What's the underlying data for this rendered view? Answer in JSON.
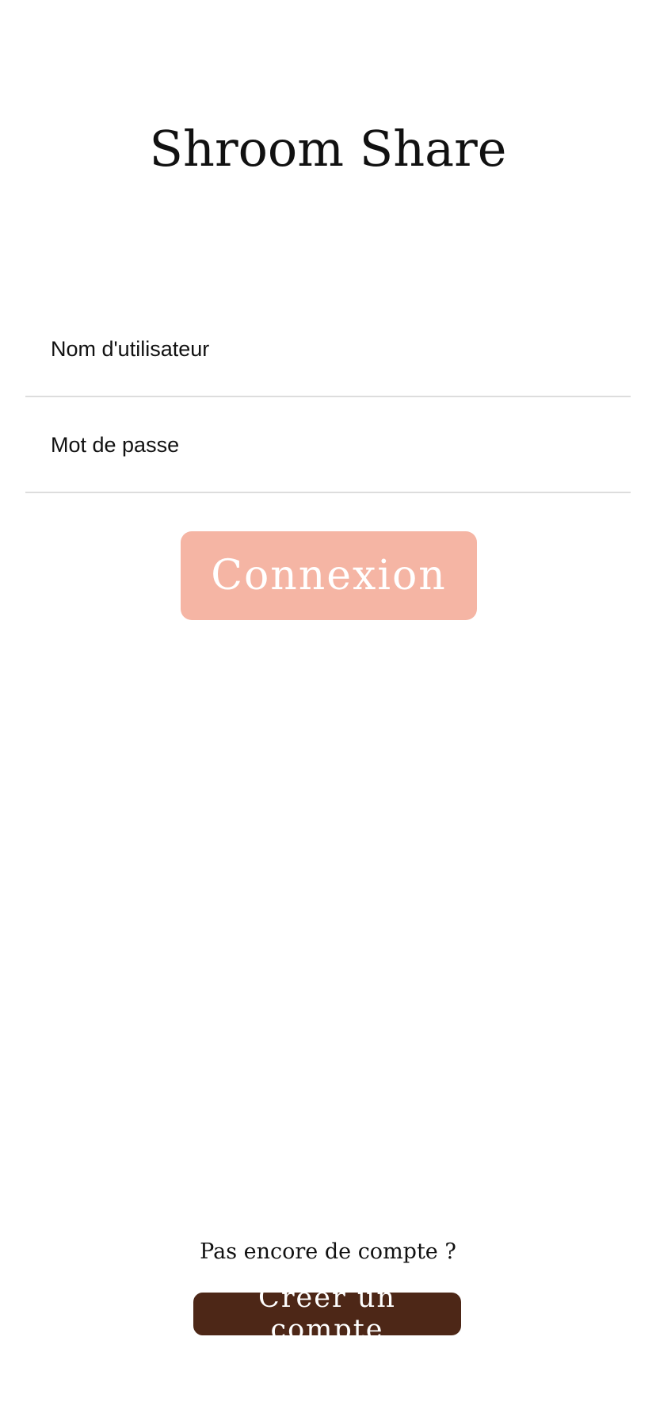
{
  "app": {
    "title": "Shroom Share"
  },
  "login_form": {
    "username_placeholder": "Nom d'utilisateur",
    "password_placeholder": "Mot de passe",
    "submit_label": "Connexion"
  },
  "footer": {
    "prompt": "Pas encore de compte ?",
    "create_account_label": "Créer un compte"
  },
  "colors": {
    "login_button": "#f5b5a4",
    "create_account_button": "#4d2717",
    "divider": "#dddddd"
  }
}
